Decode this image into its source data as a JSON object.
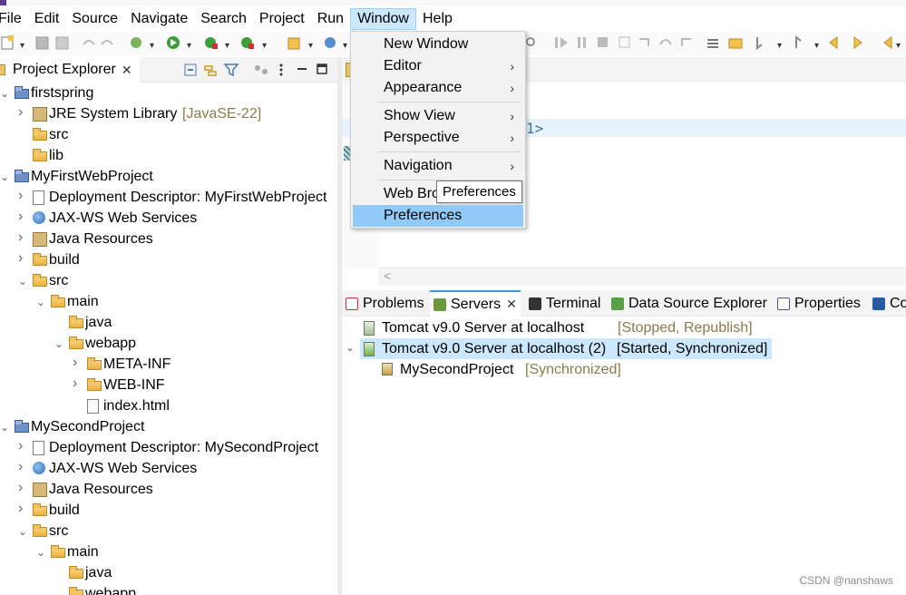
{
  "menubar": {
    "items": [
      "File",
      "Edit",
      "Source",
      "Navigate",
      "Search",
      "Project",
      "Run",
      "Window",
      "Help"
    ],
    "active": "Window"
  },
  "window_menu": {
    "items": [
      {
        "label": "New Window",
        "submenu": false
      },
      {
        "label": "Editor",
        "submenu": true
      },
      {
        "label": "Appearance",
        "submenu": true
      },
      {
        "label": "Show View",
        "submenu": true
      },
      {
        "label": "Perspective",
        "submenu": true
      },
      {
        "label": "Navigation",
        "submenu": true
      },
      {
        "label": "Web Bro",
        "submenu": false
      },
      {
        "label": "Preferences",
        "submenu": false,
        "highlighted": true
      }
    ],
    "tooltip": "Preferences"
  },
  "project_explorer": {
    "tab_label": "Project Explorer",
    "tree": [
      {
        "label": "firstspring",
        "decor": "",
        "icon": "project-icon",
        "expanded": true
      },
      {
        "label": "JRE System Library",
        "decor": "[JavaSE-22]",
        "icon": "library-icon",
        "expanded": false
      },
      {
        "label": "src",
        "decor": "",
        "icon": "folder-icon"
      },
      {
        "label": "lib",
        "decor": "",
        "icon": "folder-icon"
      },
      {
        "label": "MyFirstWebProject",
        "decor": "",
        "icon": "web-project-icon",
        "expanded": true
      },
      {
        "label": "Deployment Descriptor: MyFirstWebProject",
        "decor": "",
        "icon": "deployment-descriptor-icon",
        "expanded": false
      },
      {
        "label": "JAX-WS Web Services",
        "decor": "",
        "icon": "web-services-icon",
        "expanded": false
      },
      {
        "label": "Java Resources",
        "decor": "",
        "icon": "java-resources-icon",
        "expanded": false
      },
      {
        "label": "build",
        "decor": "",
        "icon": "folder-icon",
        "expanded": false
      },
      {
        "label": "src",
        "decor": "",
        "icon": "folder-icon",
        "expanded": true
      },
      {
        "label": "main",
        "decor": "",
        "icon": "folder-icon",
        "expanded": true
      },
      {
        "label": "java",
        "decor": "",
        "icon": "folder-icon"
      },
      {
        "label": "webapp",
        "decor": "",
        "icon": "folder-icon",
        "expanded": true
      },
      {
        "label": "META-INF",
        "decor": "",
        "icon": "folder-icon",
        "expanded": false
      },
      {
        "label": "WEB-INF",
        "decor": "",
        "icon": "folder-icon",
        "expanded": false
      },
      {
        "label": "index.html",
        "decor": "",
        "icon": "html-file-icon"
      },
      {
        "label": "MySecondProject",
        "decor": "",
        "icon": "web-project-icon",
        "expanded": true
      },
      {
        "label": "Deployment Descriptor: MySecondProject",
        "decor": "",
        "icon": "deployment-descriptor-icon",
        "expanded": false
      },
      {
        "label": "JAX-WS Web Services",
        "decor": "",
        "icon": "web-services-icon",
        "expanded": false
      },
      {
        "label": "Java Resources",
        "decor": "",
        "icon": "java-resources-icon",
        "expanded": false
      },
      {
        "label": "build",
        "decor": "",
        "icon": "folder-icon",
        "expanded": false
      },
      {
        "label": "src",
        "decor": "",
        "icon": "folder-icon",
        "expanded": true
      },
      {
        "label": "main",
        "decor": "",
        "icon": "folder-icon",
        "expanded": true
      },
      {
        "label": "java",
        "decor": "",
        "icon": "folder-icon"
      },
      {
        "label": "webapp",
        "decor": "",
        "icon": "folder-icon",
        "expanded": true
      }
    ]
  },
  "editor": {
    "visible_code": "1>"
  },
  "bottom_panel": {
    "tabs": [
      {
        "label": "Problems",
        "selected": false
      },
      {
        "label": "Servers",
        "selected": true
      },
      {
        "label": "Terminal",
        "selected": false
      },
      {
        "label": "Data Source Explorer",
        "selected": false
      },
      {
        "label": "Properties",
        "selected": false
      },
      {
        "label": "Co",
        "selected": false
      }
    ],
    "servers": [
      {
        "name": "Tomcat v9.0 Server at localhost",
        "status": "[Stopped, Republish]"
      },
      {
        "name": "Tomcat v9.0 Server at localhost (2)",
        "status": "[Started, Synchronized]",
        "selected": true,
        "expanded": true
      },
      {
        "name": "MySecondProject",
        "status": "[Synchronized]",
        "child": true
      }
    ]
  },
  "watermark": "CSDN @nanshaws",
  "colors": {
    "menu_highlight": "#91c9f7",
    "selection": "#cce8ff",
    "decoration_text": "#8d7a4f"
  }
}
